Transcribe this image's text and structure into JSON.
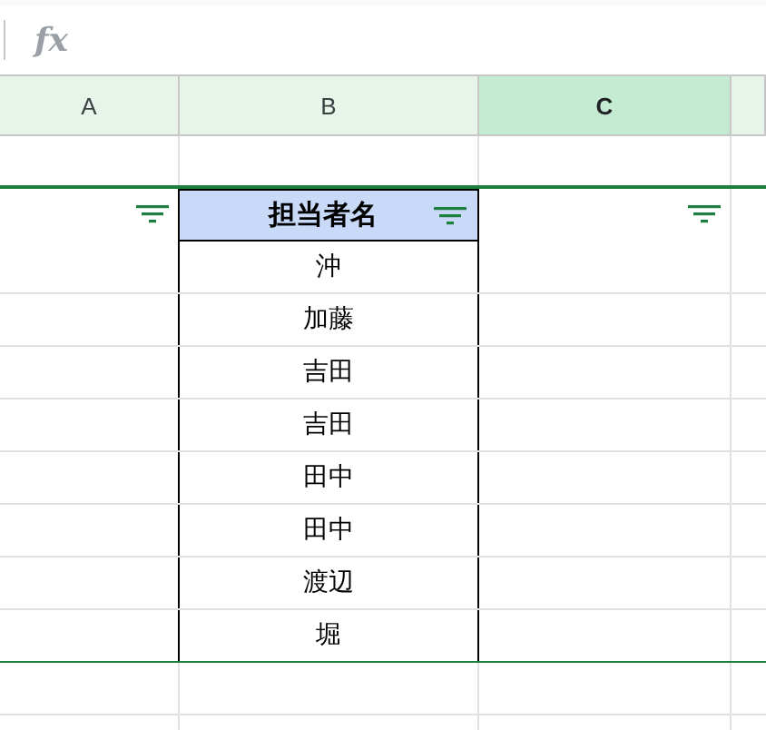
{
  "formula_bar": {
    "fx": "fx"
  },
  "columns": [
    {
      "label": "A",
      "selected": false
    },
    {
      "label": "B",
      "selected": false
    },
    {
      "label": "C",
      "selected": true
    }
  ],
  "filter_row": [
    {
      "kind": "filter"
    },
    {
      "kind": "header",
      "label": "担当者名"
    },
    {
      "kind": "filter"
    }
  ],
  "names": [
    "沖",
    "加藤",
    "吉田",
    "吉田",
    "田中",
    "田中",
    "渡辺",
    "堀"
  ]
}
